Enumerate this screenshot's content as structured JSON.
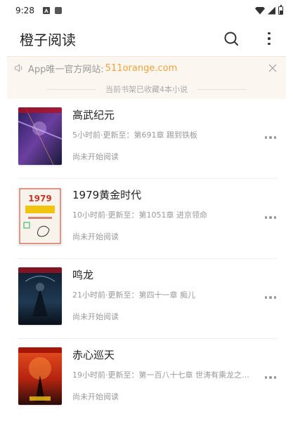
{
  "status_bar": {
    "time": "9:28",
    "left_icons": [
      "a-notification-icon",
      "square-notification-icon"
    ],
    "right_icons": [
      "wifi-icon",
      "cellular-icon",
      "battery-icon"
    ]
  },
  "header": {
    "title": "橙子阅读",
    "actions": [
      "search-icon",
      "more-vert-icon"
    ]
  },
  "notice": {
    "text": "App唯一官方网站: ",
    "link": "511orange.com",
    "accent_color": "#f2a33c"
  },
  "shelf": {
    "summary": "当前书架已收藏4本小说"
  },
  "books": [
    {
      "title": "高武纪元",
      "update": "5小时前·更新至：第691章 踢到铁板",
      "status": "尚未开始阅读",
      "cover_text": "高武纪元"
    },
    {
      "title": "1979黄金时代",
      "update": "10小时前·更新至：第1051章 进京领命",
      "status": "尚未开始阅读",
      "cover_text": "1979黄金时代"
    },
    {
      "title": "鸣龙",
      "update": "21小时前·更新至：第四十一章 痴儿",
      "status": "尚未开始阅读",
      "cover_text": "鸣龙"
    },
    {
      "title": "赤心巡天",
      "update": "19小时前·更新至：第一百八十七章 世涛有乘龙之遇，…",
      "status": "尚未开始阅读",
      "cover_text": "赤心巡天"
    }
  ]
}
